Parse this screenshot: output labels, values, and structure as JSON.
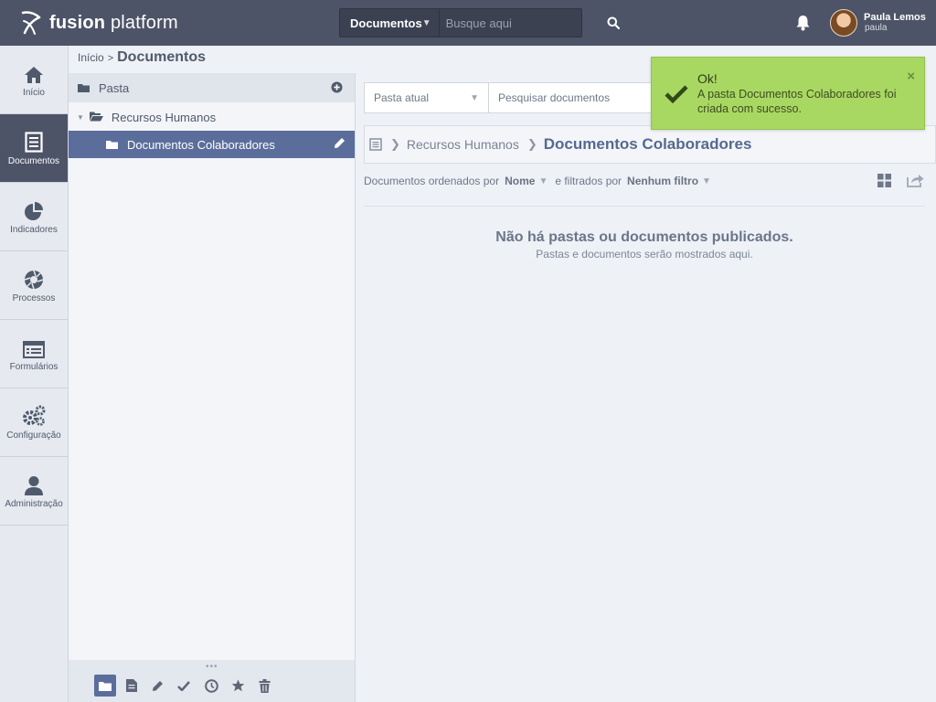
{
  "header": {
    "logo_bold": "fusion",
    "logo_light": " platform",
    "search_scope": "Documentos",
    "search_placeholder": "Busque aqui",
    "user_name": "Paula Lemos",
    "user_login": "paula"
  },
  "sidebar": {
    "items": [
      {
        "label": "Início",
        "icon": "home-icon"
      },
      {
        "label": "Documentos",
        "icon": "document-icon",
        "active": true
      },
      {
        "label": "Indicadores",
        "icon": "pie-chart-icon"
      },
      {
        "label": "Processos",
        "icon": "aperture-icon"
      },
      {
        "label": "Formulários",
        "icon": "form-icon"
      },
      {
        "label": "Configuração",
        "icon": "gears-icon"
      },
      {
        "label": "Administração",
        "icon": "user-icon"
      }
    ]
  },
  "breadcrumb": {
    "home": "Início",
    "separator": ">",
    "current": "Documentos"
  },
  "folder_panel": {
    "header_label": "Pasta",
    "tree": {
      "root": "Recursos Humanos",
      "child": "Documentos Colaboradores"
    }
  },
  "main": {
    "scope_select": "Pasta atual",
    "search_placeholder": "Pesquisar documentos",
    "path": {
      "parent": "Recursos Humanos",
      "current": "Documentos Colaboradores"
    },
    "sort": {
      "prefix": "Documentos ordenados por",
      "sort_value": "Nome",
      "filter_prefix": "e filtrados por",
      "filter_value": "Nenhum filtro"
    },
    "empty_title": "Não há pastas ou documentos publicados.",
    "empty_subtitle": "Pastas e documentos serão mostrados aqui."
  },
  "toast": {
    "title": "Ok!",
    "message": "A pasta Documentos Colaboradores foi criada com sucesso.",
    "color": "#a9d862"
  },
  "colors": {
    "topbar": "#4d5467",
    "accent": "#5b6e9b"
  }
}
